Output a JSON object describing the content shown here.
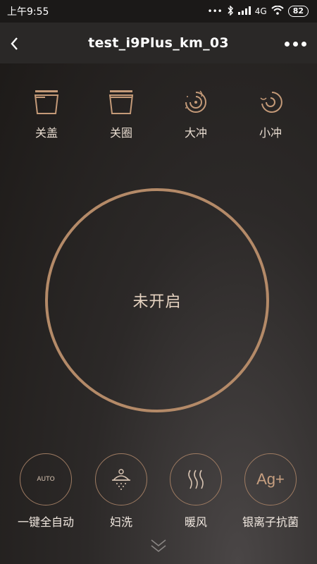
{
  "status_bar": {
    "time": "上午9:55",
    "network": "4G",
    "battery": "82"
  },
  "header": {
    "title": "test_i9Plus_km_03"
  },
  "top_actions": [
    {
      "label": "关盖",
      "icon": "lid-icon"
    },
    {
      "label": "关圈",
      "icon": "seat-ring-icon"
    },
    {
      "label": "大冲",
      "icon": "large-flush-icon"
    },
    {
      "label": "小冲",
      "icon": "small-flush-icon"
    }
  ],
  "main": {
    "status": "未开启"
  },
  "bottom_actions": [
    {
      "label": "一键全自动",
      "icon_text": "AUTO",
      "icon": "auto-icon"
    },
    {
      "label": "妇洗",
      "icon": "feminine-wash-icon"
    },
    {
      "label": "暖风",
      "icon": "warm-air-icon"
    },
    {
      "label": "银离子抗菌",
      "icon_text": "Ag+",
      "icon": "silver-ion-icon"
    }
  ],
  "colors": {
    "accent": "#b48a68",
    "header_bg": "#2a2827",
    "status_bg": "#1b1918"
  }
}
